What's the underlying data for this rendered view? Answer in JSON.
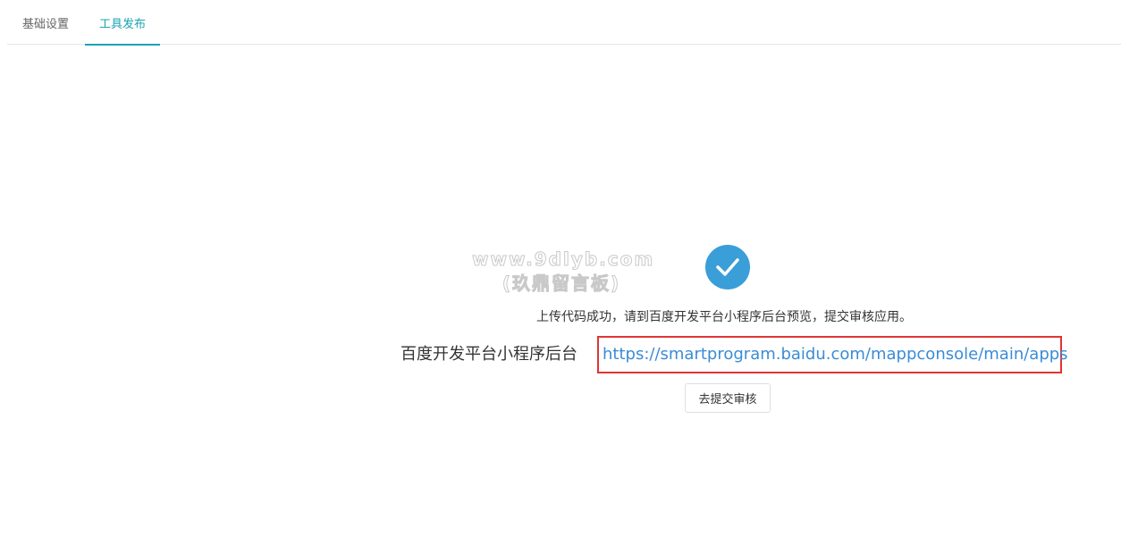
{
  "tabs": [
    {
      "label": "基础设置",
      "active": false
    },
    {
      "label": "工具发布",
      "active": true
    }
  ],
  "watermark": {
    "line1": "www.9dlyb.com",
    "line2": "(玖鼎留言板)"
  },
  "result": {
    "icon": "check-circle-icon",
    "message": "上传代码成功，请到百度开发平台小程序后台预览，提交审核应用。",
    "link_label": "百度开发平台小程序后台",
    "link_url": "https://smartprogram.baidu.com/mappconsole/main/apps",
    "submit_label": "去提交审核"
  },
  "colors": {
    "accent": "#1aa3b4",
    "success": "#3a9ed8",
    "link": "#3a8cd6",
    "highlight_box": "#e03535"
  }
}
